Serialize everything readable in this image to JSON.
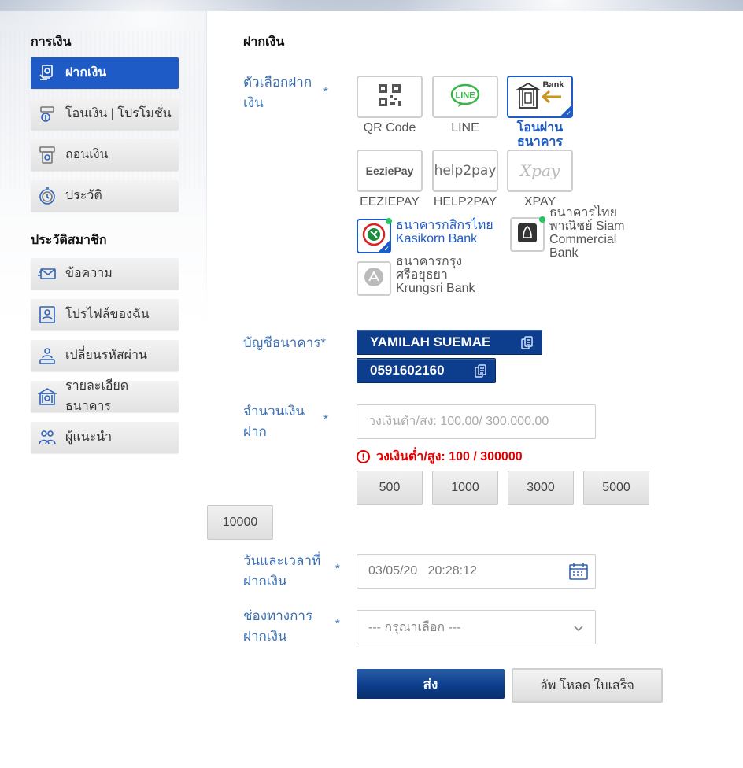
{
  "sidebar": {
    "section_finance": "การเงิน",
    "section_member": "ประวัติสมาชิก",
    "finance_items": [
      {
        "label": "ฝากเงิน",
        "icon": "deposit-icon"
      },
      {
        "label": "โอนเงิน | โปรโมชั่น",
        "icon": "transfer-icon"
      },
      {
        "label": "ถอนเงิน",
        "icon": "withdraw-icon"
      },
      {
        "label": "ประวัติ",
        "icon": "history-icon"
      }
    ],
    "member_items": [
      {
        "label": "ข้อความ",
        "icon": "mail-icon"
      },
      {
        "label": "โปรไฟล์ของฉัน",
        "icon": "profile-icon"
      },
      {
        "label": "เปลี่ยนรหัสผ่าน",
        "icon": "password-icon"
      },
      {
        "label": "รายละเอียดธนาคาร",
        "icon": "bank-icon"
      },
      {
        "label": "ผู้แนะนำ",
        "icon": "referral-icon"
      }
    ]
  },
  "main": {
    "title": "ฝากเงิน",
    "deposit_option_label": "ตัวเลือกฝากเงิน",
    "required_mark": "*",
    "options": [
      {
        "caption": "QR Code",
        "icon": "qr-icon"
      },
      {
        "caption": "LINE",
        "icon": "line-icon",
        "logo_text": "LINE"
      },
      {
        "caption": "โอนผ่านธนาคาร",
        "icon": "bank-transfer-icon",
        "logo_text": "Bank",
        "selected": true
      },
      {
        "caption": "EEZIEPAY",
        "icon": "eeziepay-icon",
        "logo_text": "EeziePay"
      },
      {
        "caption": "HELP2PAY",
        "icon": "help2pay-icon",
        "logo_text": "help2pay"
      },
      {
        "caption": "XPAY",
        "icon": "xpay-icon",
        "logo_text": "Xpay"
      }
    ],
    "banks": [
      {
        "name": "ธนาคารกสิกรไทย Kasikorn Bank",
        "icon": "kasikorn-logo-icon",
        "selected": true
      },
      {
        "name": "ธนาคารไทยพาณิชย์ Siam Commercial Bank",
        "icon": "scb-logo-icon"
      },
      {
        "name": "ธนาคารกรุงศรีอยุธยา Krungsri Bank",
        "icon": "krungsri-logo-icon"
      }
    ],
    "bank_account_label": "บัญชีธนาคาร*",
    "account_name": "YAMILAH SUEMAE",
    "account_number": "0591602160",
    "amount_label": "จำนวนเงินฝาก",
    "amount_placeholder": "วงเงินต่ำ/สง: 100.00/ 300.000.00",
    "amount_error": "วงเงินต่ำ/สูง: 100 / 300000",
    "quick_amounts": [
      "500",
      "1000",
      "3000",
      "5000",
      "10000"
    ],
    "datetime_label": "วันและเวลาที่ฝากเงิน",
    "datetime_value": "03/05/20   20:28:12",
    "channel_label": "ช่องทางการฝากเงิน",
    "channel_placeholder": "--- กรุณาเลือก ---",
    "submit_label": "ส่ง",
    "upload_label": "อัพ โหลด ใบเสร็จ"
  },
  "colors": {
    "primary": "#1e5bc6",
    "navy": "#0d3e8d",
    "error": "#e00000",
    "label": "#3a6fb3"
  }
}
